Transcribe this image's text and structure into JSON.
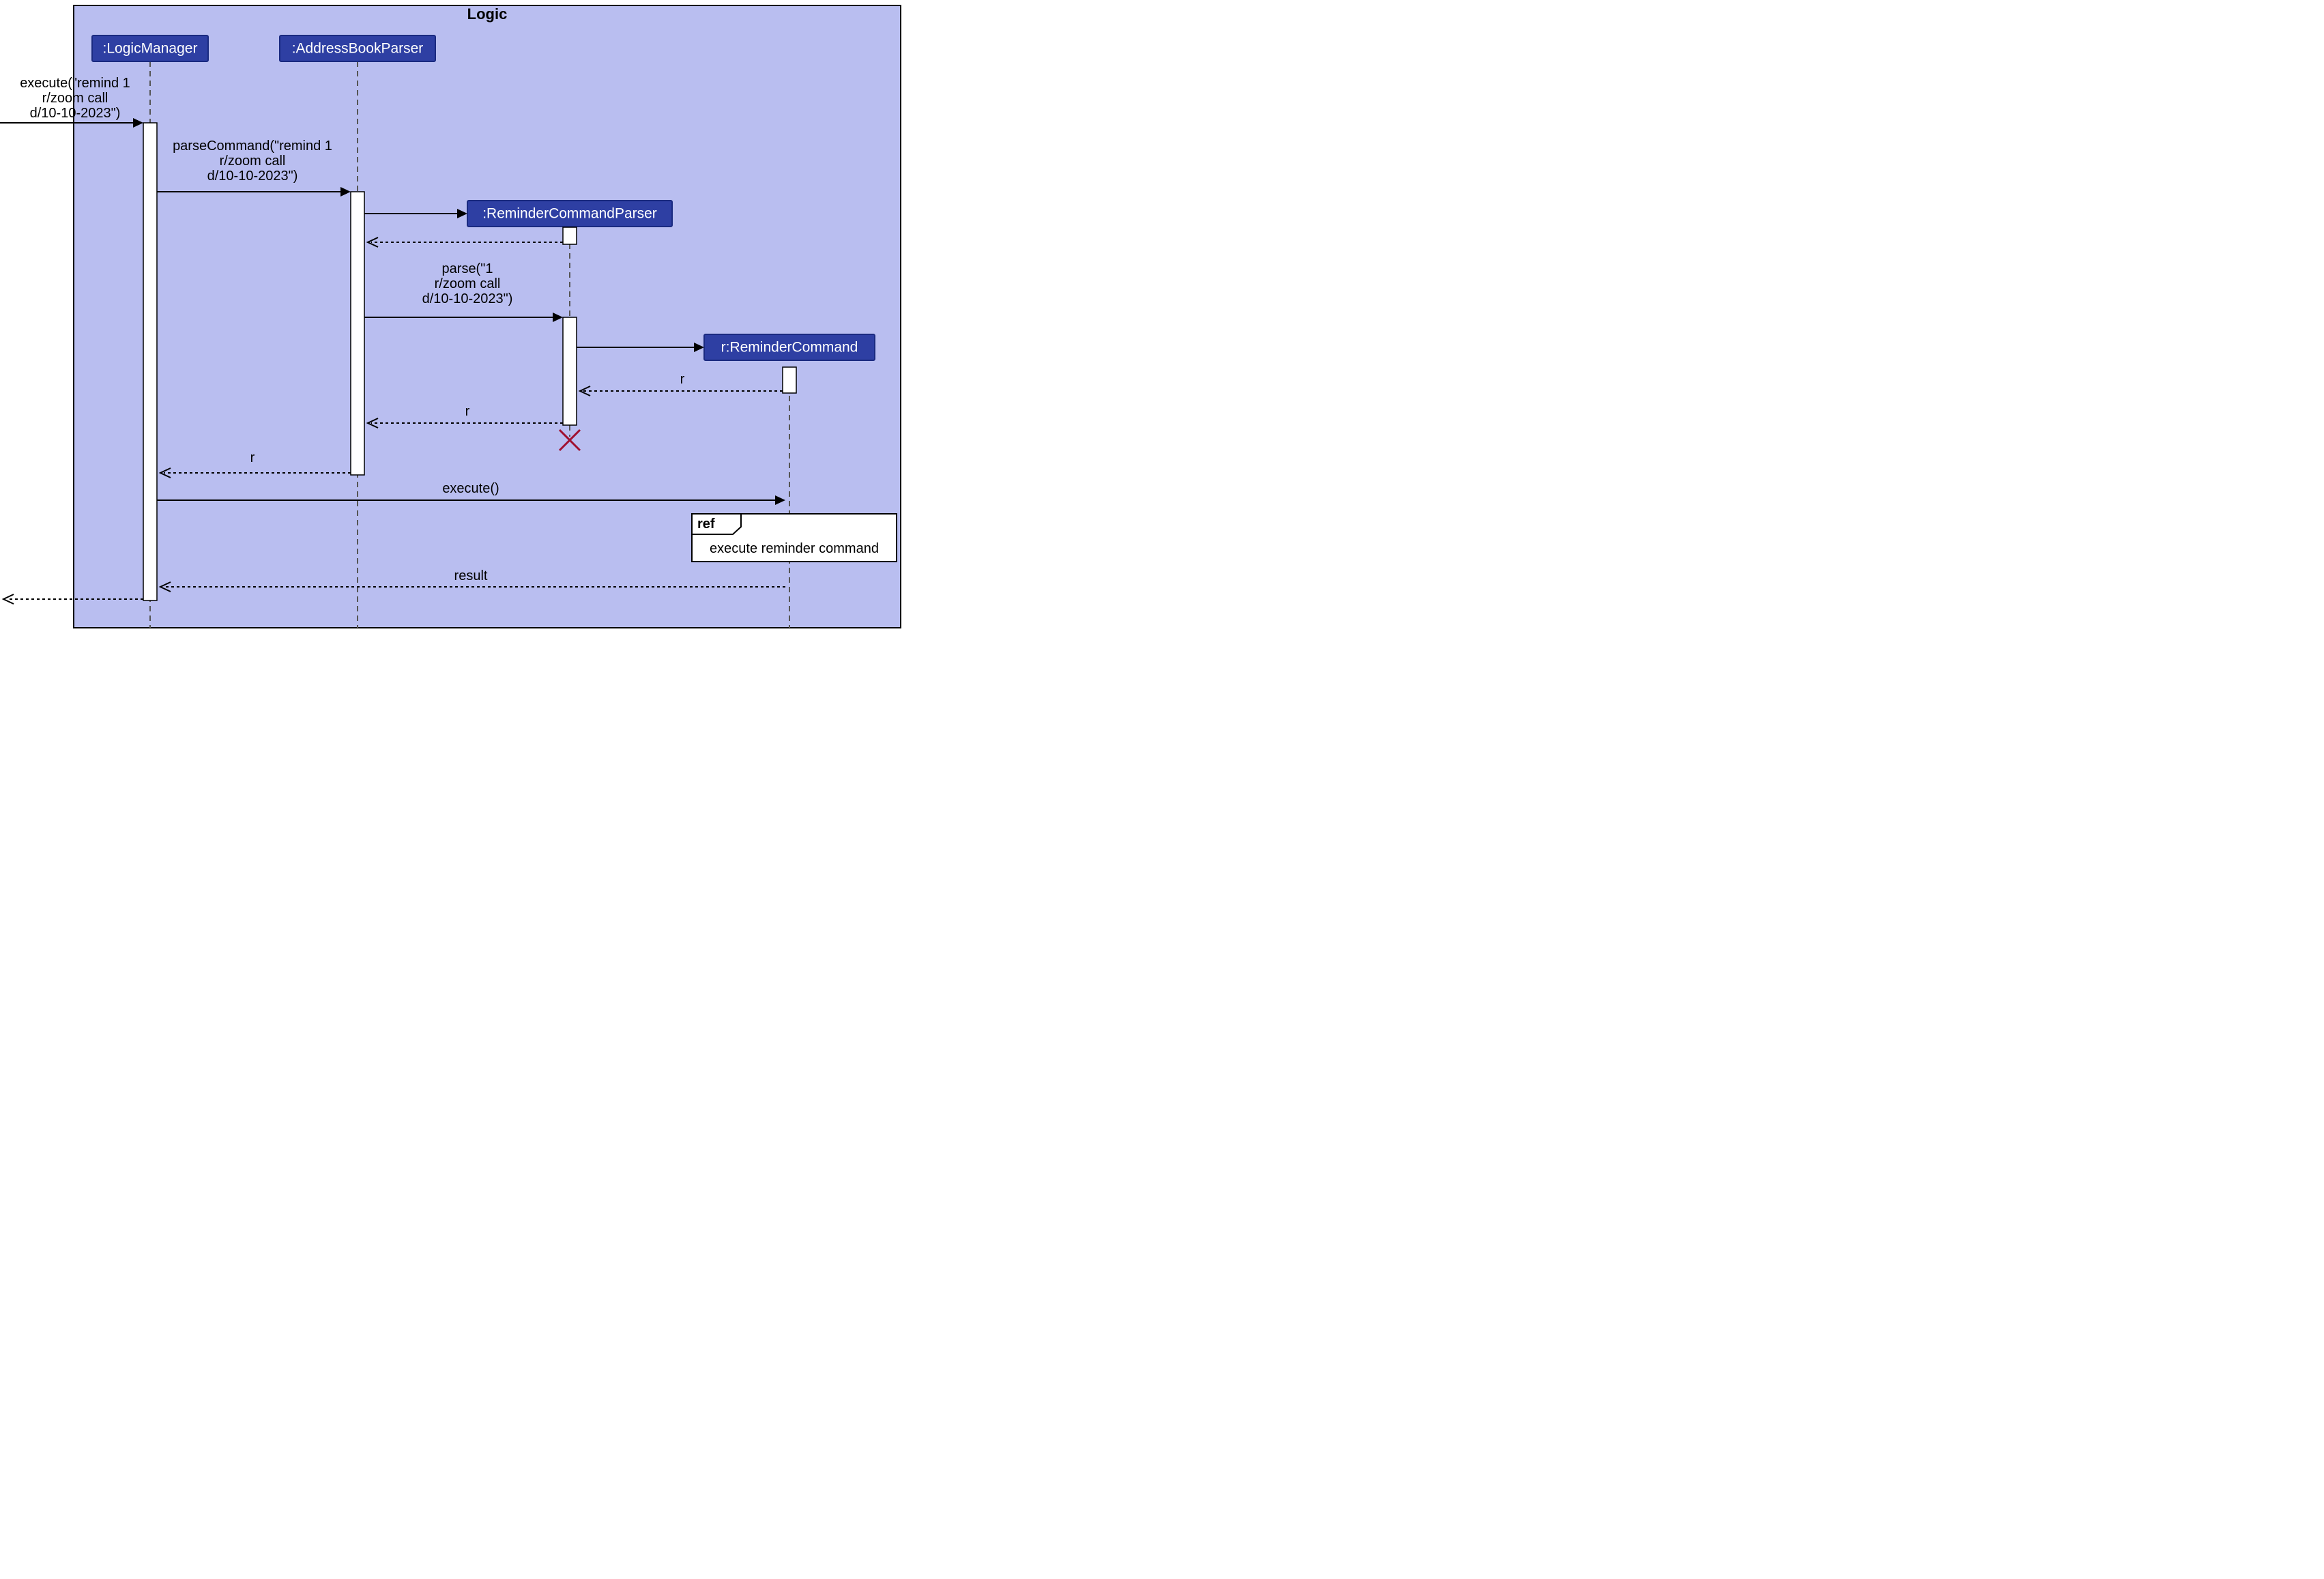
{
  "frame": {
    "title": "Logic"
  },
  "participants": {
    "logicManager": ":LogicManager",
    "addressBookParser": ":AddressBookParser",
    "reminderCommandParser": ":ReminderCommandParser",
    "reminderCommand": "r:ReminderCommand"
  },
  "messages": {
    "execute": {
      "line1": "execute(\"remind 1",
      "line2": "r/zoom call",
      "line3": "d/10-10-2023\")"
    },
    "parseCommand": {
      "line1": "parseCommand(\"remind 1",
      "line2": "r/zoom call",
      "line3": "d/10-10-2023\")"
    },
    "parse": {
      "line1": "parse(\"1",
      "line2": "r/zoom call",
      "line3": "d/10-10-2023\")"
    },
    "returnR1": "r",
    "returnR2": "r",
    "returnR3": "r",
    "execute2": "execute()",
    "result": "result"
  },
  "ref": {
    "label": "ref",
    "text": "execute reminder command"
  }
}
